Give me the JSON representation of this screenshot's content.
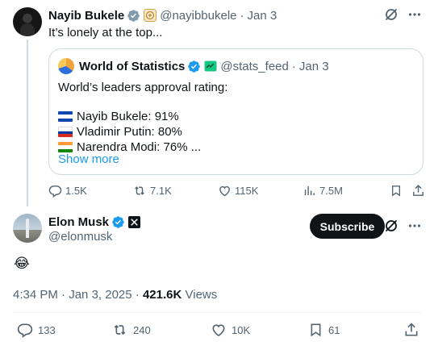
{
  "parent_tweet": {
    "author_name": "Nayib Bukele",
    "handle": "@nayibbukele",
    "separator": "·",
    "date": "Jan 3",
    "text": "It’s lonely at the top...",
    "quote": {
      "author_name": "World of Statistics",
      "handle": "@stats_feed",
      "separator": "·",
      "date": "Jan 3",
      "headline": "World’s leaders approval rating:",
      "lines": [
        {
          "text": "Nayib Bukele: 91%",
          "flag": "el-salvador-flag"
        },
        {
          "text": "Vladimir Putin: 80%",
          "flag": "russia-flag"
        },
        {
          "text": "Narendra Modi: 76% ...",
          "flag": "india-flag"
        }
      ],
      "show_more": "Show more"
    },
    "actions": {
      "replies": "1.5K",
      "reposts": "7.1K",
      "likes": "115K",
      "views": "7.5M"
    }
  },
  "main_tweet": {
    "author_name": "Elon Musk",
    "handle": "@elonmusk",
    "subscribe_label": "Subscribe",
    "text": "😂",
    "time": "4:34 PM",
    "separator": "·",
    "date": "Jan 3, 2025",
    "views_count": "421.6K",
    "views_label": "Views",
    "actions": {
      "replies": "133",
      "reposts": "240",
      "likes": "10K",
      "bookmarks": "61"
    }
  },
  "colors": {
    "text": "#0f1419",
    "secondary": "#536471",
    "link": "#1d9bf0",
    "verified_blue": "#1d9bf0",
    "verified_gray": "#829aab",
    "border": "#cfd9de"
  }
}
